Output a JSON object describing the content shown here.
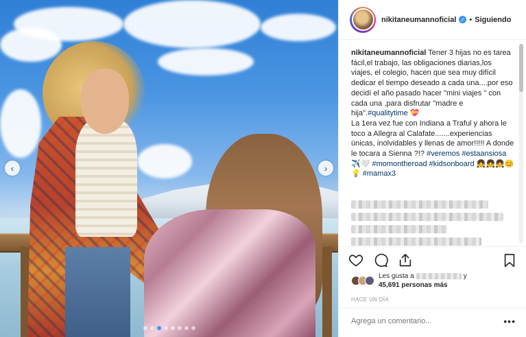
{
  "post": {
    "username": "nikitaneumannoficial",
    "verified_glyph": "✓",
    "separator": "•",
    "follow_label": "Siguiendo"
  },
  "caption": {
    "line1_text": " Tener 3 hijas no es tarea fácil,el trabajo, las obligaciones diarias,los viajes, el colegio, hacen que sea muy difícil dedicar el tiempo deseado a cada una....por eso decidí el año pasado hacer \"mini viajes \" con cada una ,para disfrutar \"madre e hija\".",
    "tag_qualitytime": "#qualitytime",
    "heart_emoji": "💝",
    "line2_text": "La 1era vez fue con Indiana a Traful y ahora le toco a Allegra al Calafate.......experiencias únicas, inolvidables y llenas de amor!!!!! A donde le tocara a Sienna ?!? ",
    "tag_veremos": "#veremos",
    "tag_estaansiosa": "#estaansiosa",
    "plane_emoji": " ✈️🤍 ",
    "tag_momontheroad": "#momontheroad",
    "tag_kidsonboard": "#kidsonboard",
    "emojis_end": " 👧👧👧😊💡 ",
    "tag_mamax3": "#mamax3"
  },
  "likes": {
    "prefix": "Les gusta a",
    "suffix": "y",
    "count_text": "45,691 personas más"
  },
  "timestamp": "HACE UN DÍA",
  "comment": {
    "placeholder": "Agrega un comentario..."
  },
  "icons": {
    "more": "•••",
    "prev": "‹",
    "next": "›"
  },
  "colors": {
    "hashtag": "#003569",
    "verified": "#3897f0",
    "active_dot": "#3897f0"
  },
  "carousel": {
    "dots": 8,
    "active_index": 2
  }
}
